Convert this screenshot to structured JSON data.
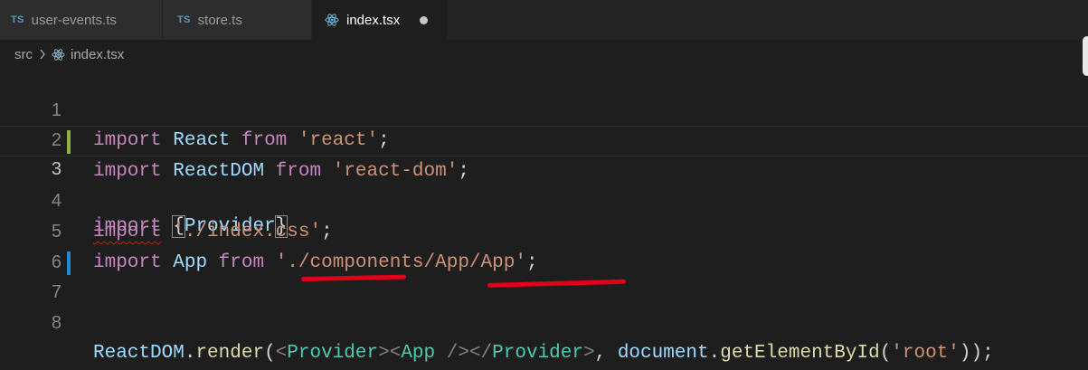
{
  "tabs": [
    {
      "icon": "TS",
      "label": "user-events.ts"
    },
    {
      "icon": "TS",
      "label": "store.ts"
    },
    {
      "icon": "react-icon",
      "label": "index.tsx",
      "active": true,
      "unsaved": true
    }
  ],
  "breadcrumb": {
    "folder": "src",
    "file": "index.tsx"
  },
  "editor": {
    "line_numbers": [
      "1",
      "2",
      "3",
      "4",
      "5",
      "6",
      "7",
      "8"
    ],
    "current_line": 3,
    "lines": {
      "l1": {
        "t1": "import",
        "t2": "React",
        "t3": "from",
        "t4": "'react'",
        "t5": ";"
      },
      "l2": {
        "t1": "import",
        "t2": "ReactDOM",
        "t3": "from",
        "t4": "'react-dom'",
        "t5": ";"
      },
      "l3": {
        "t1": "import",
        "t2": "{",
        "t3": "Provider",
        "t4": "}"
      },
      "l4": {
        "t1": "import",
        "t2": "'./index.css'",
        "t3": ";"
      },
      "l5": {
        "t1": "import",
        "t2": "App",
        "t3": "from",
        "t4": "'./components/App/App'",
        "t5": ";"
      },
      "l7": {
        "t1": "ReactDOM",
        "t2": ".",
        "t3": "render",
        "t4": "(",
        "t5": "<",
        "t6": "Provider",
        "t7": "><",
        "t8": "App",
        "t9": " /></",
        "t10": "Provider",
        "t11": ">",
        "t12": ", ",
        "t13": "document",
        "t14": ".",
        "t15": "getElementById",
        "t16": "(",
        "t17": "'root'",
        "t18": "));"
      }
    }
  },
  "colors": {
    "keyword": "#c586c0",
    "identifier": "#9cdcfe",
    "string": "#ce9178",
    "function": "#dcdcaa",
    "jsx_tag": "#4ec9b0",
    "annotation": "#e0001a",
    "gutter_modified": "#8db144",
    "gutter_added": "#1f8ad2"
  }
}
